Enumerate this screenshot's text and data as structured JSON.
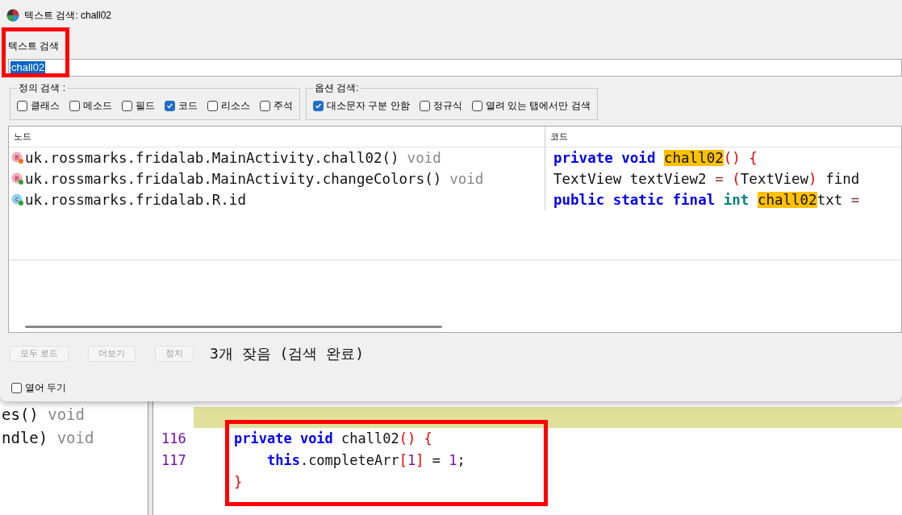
{
  "background_editor": {
    "outline_lines": [
      {
        "name": "es()",
        "type": "void"
      },
      {
        "name": "ndle)",
        "type": "void"
      }
    ],
    "code_lines": [
      {
        "number": "116",
        "tokens": [
          {
            "kind": "keyword",
            "text": "private "
          },
          {
            "kind": "keyword",
            "text": "void "
          },
          {
            "kind": "plain",
            "text": "chall02"
          },
          {
            "kind": "punct",
            "text": "() {"
          }
        ]
      },
      {
        "number": "117",
        "tokens": [
          {
            "kind": "keyword",
            "text": "    this"
          },
          {
            "kind": "plain",
            "text": ".completeArr"
          },
          {
            "kind": "punct",
            "text": "["
          },
          {
            "kind": "number",
            "text": "1"
          },
          {
            "kind": "punct",
            "text": "]"
          },
          {
            "kind": "plain",
            "text": " = "
          },
          {
            "kind": "number",
            "text": "1"
          },
          {
            "kind": "plain",
            "text": ";"
          }
        ]
      },
      {
        "tokens": [
          {
            "kind": "punct",
            "text": "}"
          }
        ]
      }
    ]
  },
  "dialog": {
    "title": "텍스트 검색: chall02",
    "search_label": "텍스트 검색",
    "search_value": "chall02",
    "definition_group": {
      "title": "정의 검색 :",
      "options": [
        {
          "label": "클래스",
          "checked": false
        },
        {
          "label": "메소드",
          "checked": false
        },
        {
          "label": "필드",
          "checked": false
        },
        {
          "label": "코드",
          "checked": true
        },
        {
          "label": "리소스",
          "checked": false
        },
        {
          "label": "주석",
          "checked": false
        }
      ]
    },
    "option_group": {
      "title": "옵션 검색:",
      "options": [
        {
          "label": "대소문자 구분 안함",
          "checked": true
        },
        {
          "label": "정규식",
          "checked": false
        },
        {
          "label": "열려 있는 탭에서만 검색",
          "checked": false
        }
      ]
    },
    "table": {
      "columns": [
        "노드",
        "코드"
      ],
      "rows": [
        {
          "kind": "method",
          "icon_letter": "m",
          "color": "#f07020",
          "node": "uk.rossmarks.fridalab.MainActivity.chall02()",
          "type": "void",
          "code": [
            {
              "kind": "keyword",
              "text": "private "
            },
            {
              "kind": "keyword",
              "text": "void "
            },
            {
              "kind": "match",
              "text": "chall02"
            },
            {
              "kind": "punct",
              "text": "() {"
            }
          ]
        },
        {
          "kind": "method",
          "icon_letter": "m",
          "color": "#30a030",
          "node": "uk.rossmarks.fridalab.MainActivity.changeColors()",
          "type": "void",
          "code": [
            {
              "kind": "plain",
              "text": "TextView textView2 "
            },
            {
              "kind": "op",
              "text": "= "
            },
            {
              "kind": "punct",
              "text": "("
            },
            {
              "kind": "plain",
              "text": "TextView"
            },
            {
              "kind": "punct",
              "text": ")"
            },
            {
              "kind": "plain",
              "text": " find"
            }
          ]
        },
        {
          "kind": "class",
          "icon_letter": "c",
          "color": "#30a030",
          "node": "uk.rossmarks.fridalab.R.id",
          "code": [
            {
              "kind": "keyword",
              "text": "public "
            },
            {
              "kind": "keyword",
              "text": "static "
            },
            {
              "kind": "keyword",
              "text": "final "
            },
            {
              "kind": "type",
              "text": "int "
            },
            {
              "kind": "match",
              "text": "chall02"
            },
            {
              "kind": "plain",
              "text": "txt "
            },
            {
              "kind": "op",
              "text": "="
            }
          ]
        }
      ]
    },
    "buttons": [
      {
        "label": "모두 로드",
        "disabled": true
      },
      {
        "label": "더보기",
        "disabled": true
      },
      {
        "label": "정지",
        "disabled": true
      }
    ],
    "status": "3개 잦음 (검색 완료)",
    "keep_open": {
      "label": "열어 두기",
      "checked": false
    }
  }
}
